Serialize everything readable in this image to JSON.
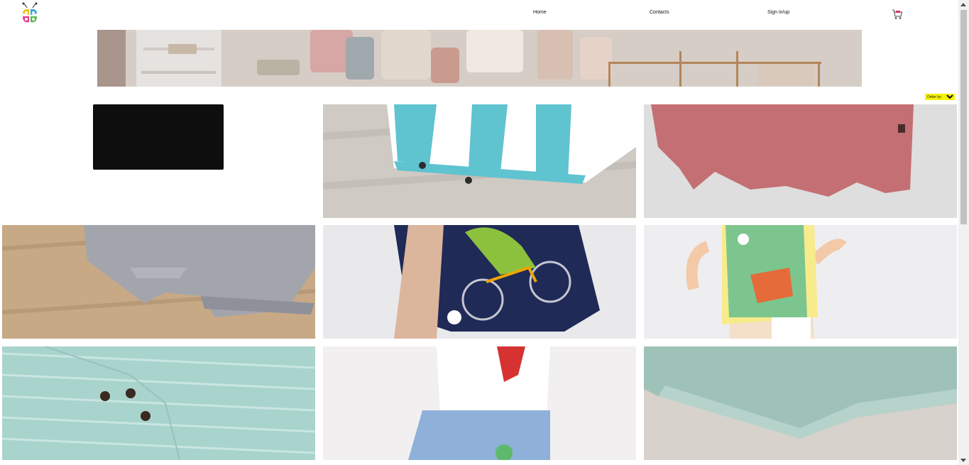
{
  "nav": {
    "home": "Home",
    "contacts": "Contacts",
    "sign": "Sign in/up"
  },
  "order_by": {
    "label": "Order by:"
  },
  "colors": {
    "order_by_bg": "#f5f20c"
  }
}
